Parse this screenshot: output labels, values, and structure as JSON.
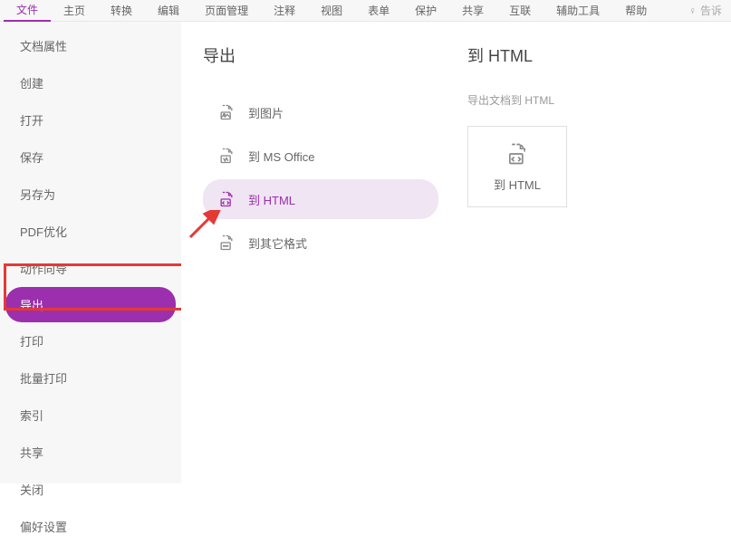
{
  "toolbar": {
    "tabs": [
      "文件",
      "主页",
      "转换",
      "编辑",
      "页面管理",
      "注释",
      "视图",
      "表单",
      "保护",
      "共享",
      "互联",
      "辅助工具",
      "帮助"
    ],
    "active_index": 0,
    "tell_me": "告诉"
  },
  "sidebar": {
    "items": [
      {
        "label": "文档属性"
      },
      {
        "label": "创建"
      },
      {
        "label": "打开"
      },
      {
        "label": "保存"
      },
      {
        "label": "另存为"
      },
      {
        "label": "PDF优化"
      },
      {
        "label": "动作向导"
      },
      {
        "label": "导出",
        "selected": true
      },
      {
        "label": "打印"
      },
      {
        "label": "批量打印"
      },
      {
        "label": "索引"
      },
      {
        "label": "共享"
      },
      {
        "label": "关闭"
      },
      {
        "label": "偏好设置"
      }
    ]
  },
  "export": {
    "title": "导出",
    "options": [
      {
        "label": "到图片"
      },
      {
        "label": "到 MS Office"
      },
      {
        "label": "到 HTML",
        "selected": true
      },
      {
        "label": "到其它格式"
      }
    ]
  },
  "detail": {
    "title": "到 HTML",
    "desc": "导出文档到 HTML",
    "button": "到 HTML"
  }
}
